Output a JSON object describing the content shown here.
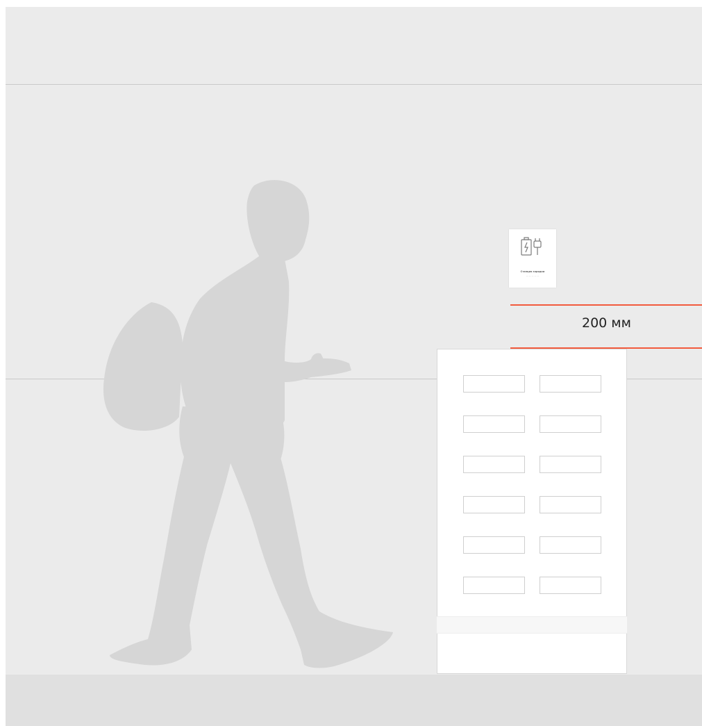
{
  "dimension": {
    "label": "200 мм"
  },
  "sign": {
    "icon": "charging-battery-plug-icon",
    "title": "Станция зарядки",
    "subtitle": "— — — — —"
  },
  "cabinet": {
    "rows": 6,
    "columns": 2
  },
  "colors": {
    "accent": "#f25a3c",
    "wall": "#ebebeb",
    "floor": "#e0e0e0",
    "silhouette": "#d6d6d6"
  }
}
